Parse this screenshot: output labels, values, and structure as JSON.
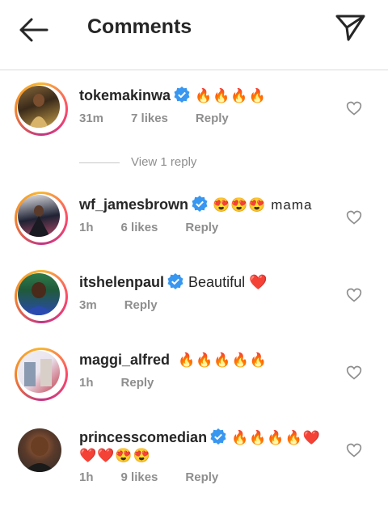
{
  "header": {
    "title": "Comments",
    "back_icon": "arrow-left-icon",
    "send_icon": "paper-plane-icon"
  },
  "comments": [
    {
      "username": "tokemakinwa",
      "verified": true,
      "text": "🔥🔥🔥🔥",
      "time": "31m",
      "likes": "7 likes",
      "reply": "Reply",
      "avatar_colors": [
        "#3a2a1a",
        "#c9a24a"
      ]
    },
    {
      "username": "wf_jamesbrown",
      "verified": true,
      "text": "😍😍😍 mama",
      "time": "1h",
      "likes": "6 likes",
      "reply": "Reply",
      "avatar_colors": [
        "#1f2233",
        "#b04a6a"
      ]
    },
    {
      "username": "itshelenpaul",
      "verified": true,
      "text": "Beautiful ❤️",
      "time": "3m",
      "likes": "",
      "reply": "Reply",
      "avatar_colors": [
        "#1f5a3a",
        "#2a4ab0"
      ]
    },
    {
      "username": "maggi_alfred",
      "verified": false,
      "text": "🔥🔥🔥🔥🔥",
      "time": "1h",
      "likes": "",
      "reply": "Reply",
      "avatar_colors": [
        "#e9e4ee",
        "#c23a4a"
      ]
    },
    {
      "username": "princesscomedian",
      "verified": true,
      "text": "🔥🔥🔥🔥❤️",
      "text_line2": "❤️❤️😍😍",
      "time": "1h",
      "likes": "9 likes",
      "reply": "Reply",
      "avatar_colors": [
        "#2b2b2b",
        "#a8653a"
      ]
    }
  ],
  "view_replies": "View 1 reply",
  "colors": {
    "verified_blue": "#3897f0",
    "meta_gray": "#8e8e8e",
    "text": "#262626"
  }
}
